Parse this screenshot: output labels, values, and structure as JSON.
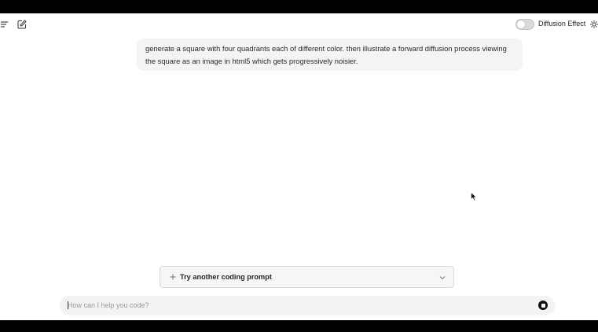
{
  "header": {
    "toggle_label": "Diffusion Effect",
    "toggle_on": false
  },
  "conversation": {
    "user_message": "generate a square with four quadrants each of different color. then illustrate a forward diffusion process viewing the square as an image in html5 which gets progressively noisier."
  },
  "suggestion": {
    "label": "Try another coding prompt"
  },
  "composer": {
    "placeholder": "How can I help you code?",
    "value": ""
  },
  "icons": {
    "menu": "menu-icon",
    "edit": "edit-icon",
    "theme": "sun-icon",
    "plus": "plus-icon",
    "chevron": "chevron-down-icon",
    "stop": "stop-icon"
  }
}
